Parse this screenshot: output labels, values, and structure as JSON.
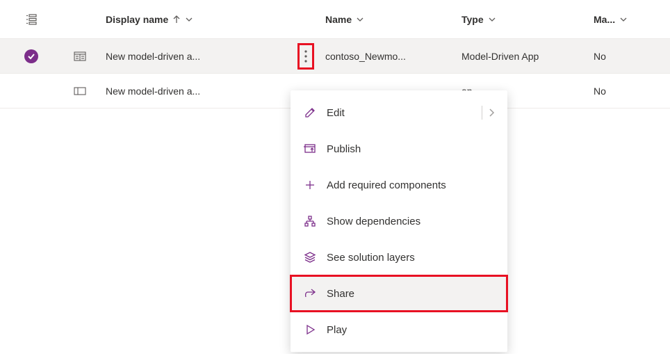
{
  "columns": {
    "display_name": "Display name",
    "name": "Name",
    "type": "Type",
    "managed": "Ma..."
  },
  "rows": [
    {
      "selected": true,
      "display_name": "New model-driven a...",
      "name": "contoso_Newmo...",
      "type": "Model-Driven App",
      "managed": "No",
      "icon": "form-icon"
    },
    {
      "selected": false,
      "display_name": "New model-driven a...",
      "name": "",
      "type": "ap",
      "managed": "No",
      "icon": "panel-icon"
    }
  ],
  "menu": {
    "edit": "Edit",
    "publish": "Publish",
    "add_components": "Add required components",
    "show_dependencies": "Show dependencies",
    "see_layers": "See solution layers",
    "share": "Share",
    "play": "Play"
  }
}
